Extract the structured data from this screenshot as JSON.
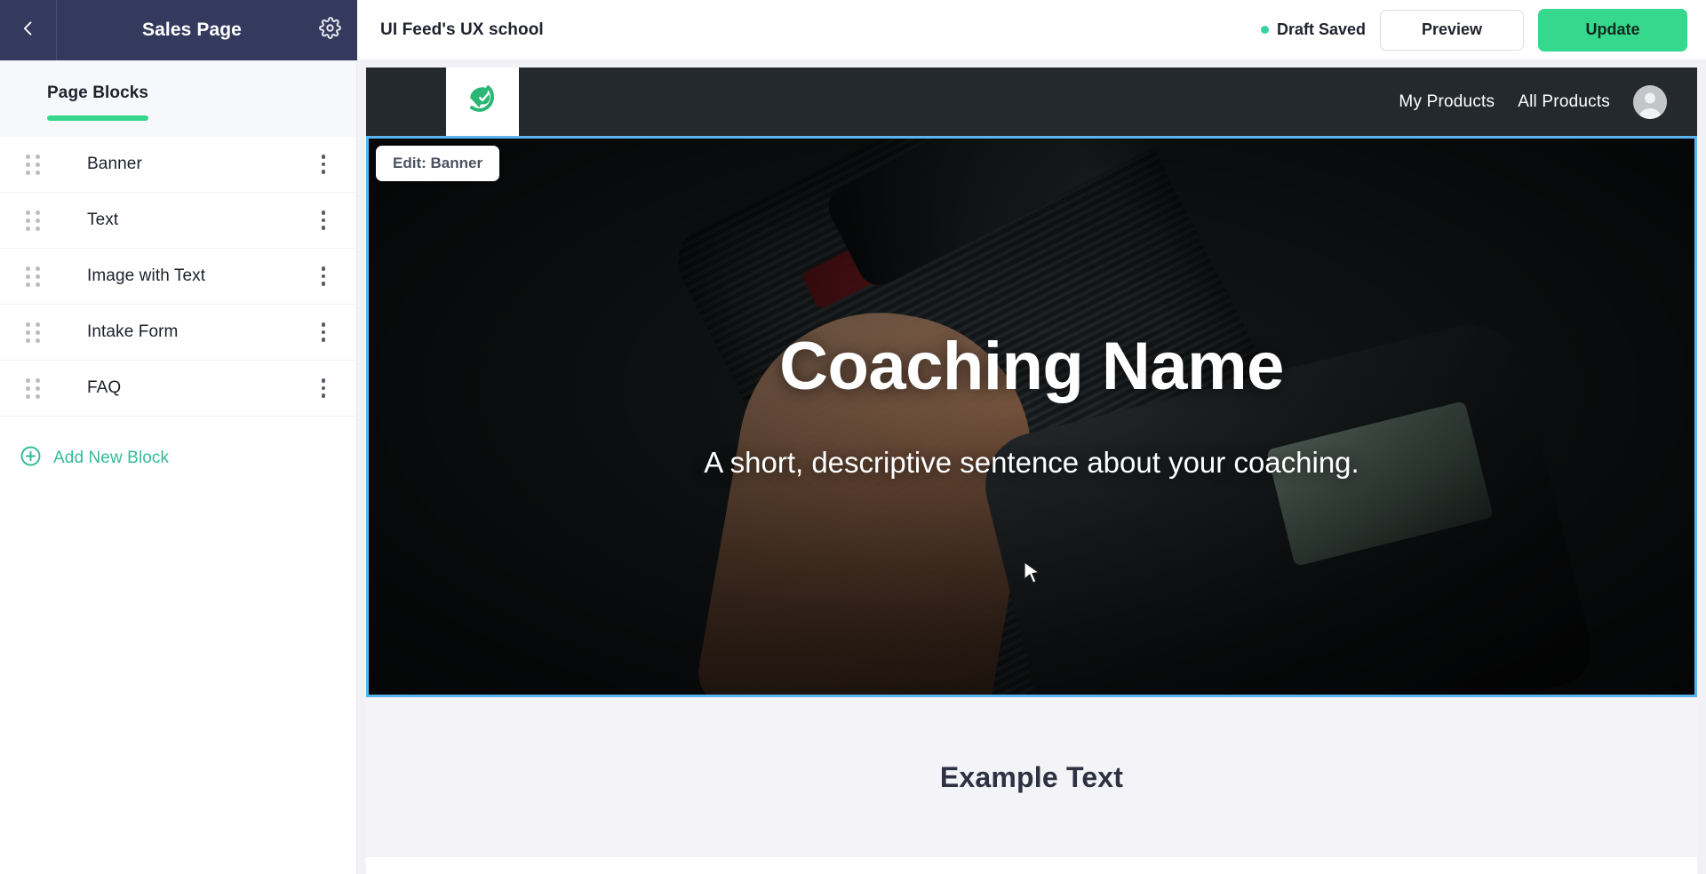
{
  "editor": {
    "back_icon": "chevron-left-icon",
    "panel_title": "Sales Page",
    "settings_icon": "gear-icon",
    "app_title": "UI Feed's UX school",
    "draft_status": "Draft Saved",
    "preview_label": "Preview",
    "update_label": "Update",
    "accent_green": "#36d88d",
    "panel_navy": "#343a5e",
    "selection_blue": "#5ab4ef"
  },
  "sidebar": {
    "tab_label": "Page Blocks",
    "blocks": [
      {
        "name": "Banner"
      },
      {
        "name": "Text"
      },
      {
        "name": "Image with Text"
      },
      {
        "name": "Intake Form"
      },
      {
        "name": "FAQ"
      }
    ],
    "add_block_label": "Add New Block",
    "add_block_icon": "plus-circle-icon",
    "drag_icon": "drag-handle-icon",
    "menu_icon": "kebab-menu-icon"
  },
  "preview": {
    "logo_icon": "leaf-check-logo",
    "nav_links": [
      {
        "label": "My Products"
      },
      {
        "label": "All Products"
      }
    ],
    "avatar_icon": "user-avatar-icon",
    "edit_pill_label": "Edit: Banner",
    "banner": {
      "title": "Coaching Name",
      "subtitle": "A short, descriptive sentence about your coaching."
    },
    "text_block": {
      "title": "Example Text"
    }
  }
}
